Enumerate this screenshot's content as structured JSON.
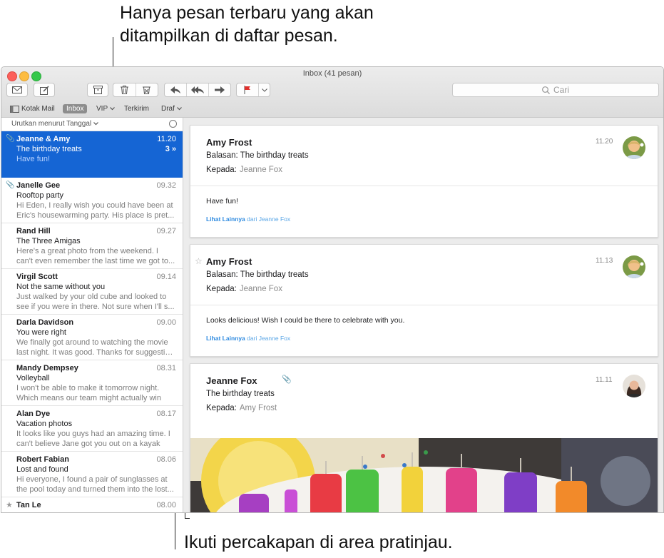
{
  "callouts": {
    "top_line1": "Hanya pesan terbaru yang akan",
    "top_line2": "ditampilkan di daftar pesan.",
    "bottom": "Ikuti percakapan di area pratinjau."
  },
  "window": {
    "title": "Inbox (41 pesan)"
  },
  "toolbar": {
    "search_placeholder": "Cari",
    "icons": [
      "envelope-icon",
      "compose-icon",
      "archive-icon",
      "trash-icon",
      "junk-icon",
      "reply-icon",
      "reply-all-icon",
      "forward-icon",
      "flag-icon",
      "chevron-down-icon",
      "search-icon"
    ],
    "flag_color": "#e0302d"
  },
  "favorites": {
    "mailboxes": "Kotak Mail",
    "inbox": "Inbox",
    "vip": "VIP",
    "sent": "Terkirim",
    "drafts": "Draf"
  },
  "list": {
    "sort_label": "Urutkan menurut Tanggal",
    "messages": [
      {
        "sender": "Jeanne & Amy",
        "time": "11.20",
        "subject": "The birthday treats",
        "preview1": "Have fun!",
        "preview2": "",
        "count": "3 »",
        "attachment": true,
        "selected": true
      },
      {
        "sender": "Janelle Gee",
        "time": "09.32",
        "subject": "Rooftop party",
        "preview1": "Hi Eden, I really wish you could have been at",
        "preview2": "Eric's housewarming party. His place is pret...",
        "attachment": true
      },
      {
        "sender": "Rand Hill",
        "time": "09.27",
        "subject": "The Three Amigas",
        "preview1": "Here's a great photo from the weekend. I",
        "preview2": "can't even remember the last time we got to..."
      },
      {
        "sender": "Virgil Scott",
        "time": "09.14",
        "subject": "Not the same without you",
        "preview1": "Just walked by your old cube and looked to",
        "preview2": "see if you were in there. Not sure when I'll s..."
      },
      {
        "sender": "Darla Davidson",
        "time": "09.00",
        "subject": "You were right",
        "preview1": "We finally got around to watching the movie",
        "preview2": "last night. It was good. Thanks for suggestin..."
      },
      {
        "sender": "Mandy Dempsey",
        "time": "08.31",
        "subject": "Volleyball",
        "preview1": "I won't be able to make it tomorrow night.",
        "preview2": "Which means our team might actually win"
      },
      {
        "sender": "Alan Dye",
        "time": "08.17",
        "subject": "Vacation photos",
        "preview1": "It looks like you guys had an amazing time. I",
        "preview2": "can't believe Jane got you out on a kayak"
      },
      {
        "sender": "Robert Fabian",
        "time": "08.06",
        "subject": "Lost and found",
        "preview1": "Hi everyone, I found a pair of sunglasses at",
        "preview2": "the pool today and turned them into the lost..."
      },
      {
        "sender": "Tan Le",
        "time": "08.00",
        "star": true
      }
    ]
  },
  "conversation": [
    {
      "from": "Amy Frost",
      "time": "11.20",
      "subject": "Balasan: The birthday treats",
      "to_label": "Kepada:",
      "to": "Jeanne Fox",
      "body": "Have fun!",
      "more_bold": "Lihat Lainnya",
      "more_rest": " dari Jeanne Fox"
    },
    {
      "from": "Amy Frost",
      "time": "11.13",
      "subject": "Balasan: The birthday treats",
      "to_label": "Kepada:",
      "to": "Jeanne Fox",
      "body": "Looks delicious! Wish I could be there to celebrate with you.",
      "more_bold": "Lihat Lainnya",
      "more_rest": " dari Jeanne Fox",
      "star": true
    },
    {
      "from": "Jeanne Fox",
      "time": "11.11",
      "subject": "The birthday treats",
      "to_label": "Kepada:",
      "to": "Amy Frost",
      "attachment": true
    }
  ],
  "colors": {
    "selection": "#1565d4",
    "link": "#2f8be0",
    "close": "#fc605b",
    "minimize": "#fdbc40",
    "maximize": "#34c84a"
  }
}
